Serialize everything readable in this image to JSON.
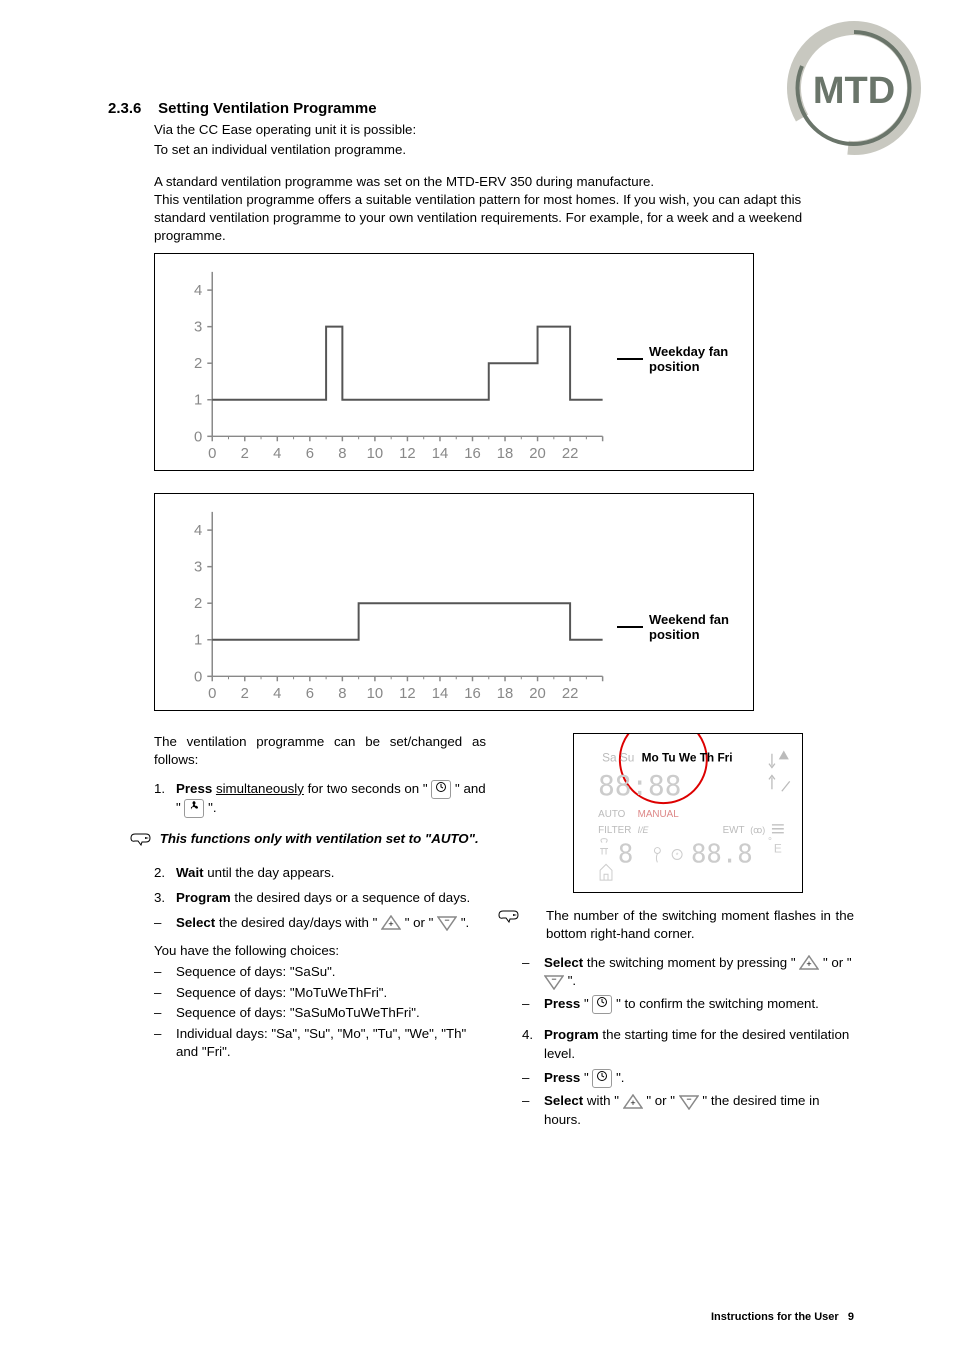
{
  "section": {
    "number": "2.3.6",
    "title": "Setting Ventilation Programme",
    "intro_l1": "Via the CC Ease operating unit it is possible:",
    "intro_l2": "To set an individual ventilation programme.",
    "para1": "A standard ventilation programme was set on the MTD-ERV 350 during manufacture.",
    "para2": "This ventilation programme offers a suitable ventilation pattern for most homes. If you wish, you can adapt this standard ventilation programme to your own ventilation requirements. For example, for a week and a weekend programme."
  },
  "chart_data": [
    {
      "type": "line",
      "title": "",
      "label": "Weekday fan position",
      "xlabel": "",
      "ylabel": "",
      "xticks": [
        0,
        2,
        4,
        6,
        8,
        10,
        12,
        14,
        16,
        18,
        20,
        22
      ],
      "yticks": [
        0,
        1,
        2,
        3,
        4
      ],
      "ylim": [
        0,
        4.5
      ],
      "x": [
        0,
        7,
        7,
        8,
        8,
        17,
        17,
        20,
        20,
        22,
        22,
        24
      ],
      "y": [
        1,
        1,
        3,
        3,
        1,
        1,
        2,
        2,
        3,
        3,
        1,
        1
      ]
    },
    {
      "type": "line",
      "title": "",
      "label": "Weekend fan position",
      "xlabel": "",
      "ylabel": "",
      "xticks": [
        0,
        2,
        4,
        6,
        8,
        10,
        12,
        14,
        16,
        18,
        20,
        22
      ],
      "yticks": [
        0,
        1,
        2,
        3,
        4
      ],
      "ylim": [
        0,
        4.5
      ],
      "x": [
        0,
        9,
        9,
        22,
        22,
        24
      ],
      "y": [
        1,
        1,
        2,
        2,
        1,
        1
      ]
    }
  ],
  "body": {
    "lead": "The ventilation programme can be set/changed as follows:",
    "step1_a": "Press",
    "step1_u": "simultaneously",
    "step1_b": " for two seconds on \"",
    "step1_c": "\" and \" ",
    "step1_d": " \".",
    "note1": "This functions only with ventilation set to \"AUTO\".",
    "step2_a": "Wait",
    "step2_b": " until the day appears.",
    "step3_a": "Program",
    "step3_b": " the desired days or a sequence of days.",
    "sub_select_a": "Select",
    "sub_select_b": " the desired day/days with \" ",
    "sub_select_c": " \" or \"",
    "sub_select_d": " \".",
    "choices_lead": "You have the following choices:",
    "choice1": "Sequence of days: \"SaSu\".",
    "choice2": "Sequence of days: \"MoTuWeThFri\".",
    "choice3": "Sequence of days: \"SaSuMoTuWeThFri\".",
    "choice4": "Individual days: \"Sa\", \"Su\", \"Mo\", \"Tu\", \"We\", \"Th\" and \"Fri\".",
    "note2": "The number of the switching moment flashes in the bottom right-hand corner.",
    "r_sub1_a": "Select",
    "r_sub1_b": " the switching moment by pressing \"",
    "r_sub1_c": " \" or \" ",
    "r_sub1_d": " \".",
    "r_sub2_a": "Press",
    "r_sub2_b": " \" ",
    "r_sub2_c": " \" to confirm the switching moment.",
    "step4_a": "Program",
    "step4_b": " the starting time for the desired ventilation level.",
    "r_sub3_a": "Press",
    "r_sub3_b": " \" ",
    "r_sub3_c": " \".",
    "r_sub4_a": "Select",
    "r_sub4_b": " with \" ",
    "r_sub4_c": " \" or \" ",
    "r_sub4_d": " \" the desired time in hours.",
    "device_days": "Mo Tu We Th Fri",
    "device_sasu": "Sa Su",
    "device_auto": "AUTO",
    "device_manual": "MANUAL",
    "device_filter": "FILTER",
    "device_ie": "I/E",
    "device_ewt": "EWT",
    "device_degE": "° E"
  },
  "footer": {
    "label": "Instructions for the User",
    "page": "9"
  }
}
